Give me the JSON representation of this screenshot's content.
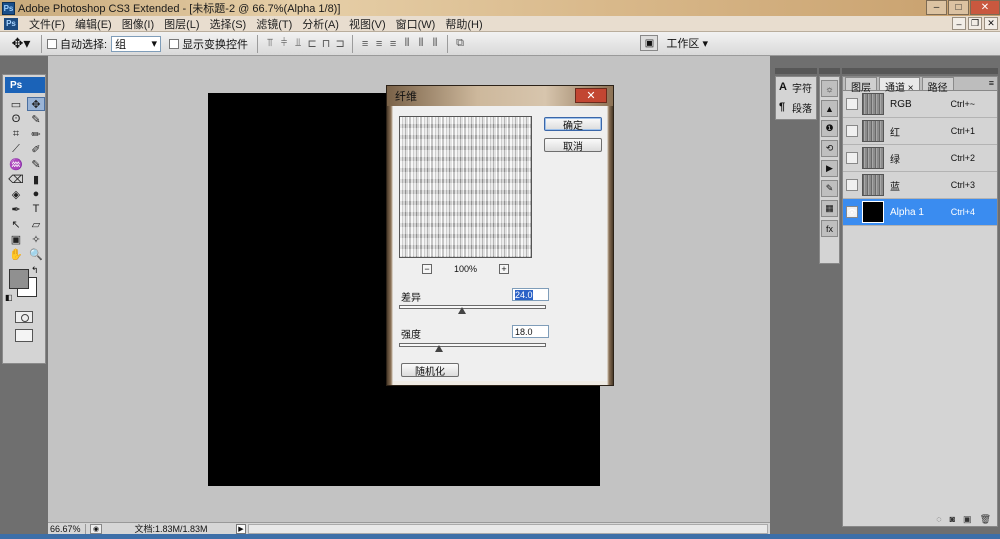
{
  "app": {
    "window_title": "Adobe Photoshop CS3 Extended - [未标题-2 @ 66.7%(Alpha 1/8)]",
    "icon": "Ps"
  },
  "menu": [
    "文件(F)",
    "编辑(E)",
    "图像(I)",
    "图层(L)",
    "选择(S)",
    "滤镜(T)",
    "分析(A)",
    "视图(V)",
    "窗口(W)",
    "帮助(H)"
  ],
  "options": {
    "auto_select_label": "自动选择:",
    "auto_select_value": "组",
    "show_transform_label": "显示变换控件",
    "workspace_label": "工作区 ▾"
  },
  "toolbox": {
    "logo": "Ps",
    "tools": [
      "▭",
      "✥",
      "ʘ",
      "✎",
      "⌗",
      "✏",
      "⟋",
      "✐",
      "♒",
      "✎",
      "⌫",
      "▮",
      "◈",
      "●",
      "✒",
      "T",
      "↖",
      "▱",
      "▣",
      "✧",
      "✋",
      "🔍"
    ]
  },
  "status": {
    "zoom": "66.67%",
    "doc_info": "文档:1.83M/1.83M"
  },
  "panels": {
    "strip_a": [
      {
        "icon": "A",
        "label": "字符"
      },
      {
        "icon": "¶",
        "label": "段落"
      }
    ],
    "strip_b": [
      "☼",
      "▲",
      "❶",
      "⟲",
      "▶",
      "✎",
      "▦",
      "fx"
    ],
    "tabs": [
      "图层",
      "通道 ×",
      "路径"
    ],
    "channels": [
      {
        "name": "RGB",
        "shortcut": "Ctrl+~"
      },
      {
        "name": "红",
        "shortcut": "Ctrl+1"
      },
      {
        "name": "绿",
        "shortcut": "Ctrl+2"
      },
      {
        "name": "蓝",
        "shortcut": "Ctrl+3"
      },
      {
        "name": "Alpha 1",
        "shortcut": "Ctrl+4"
      }
    ]
  },
  "dialog": {
    "title": "纤维",
    "ok_label": "确定",
    "cancel_label": "取消",
    "zoom": "100%",
    "variance_label": "差异",
    "variance_value": "24.0",
    "strength_label": "强度",
    "strength_value": "18.0",
    "randomize_label": "随机化",
    "variance_level_pct": 43,
    "strength_level_pct": 27
  },
  "colors": {
    "selected_channel": "#3a8cf0",
    "foreground": "#909090",
    "background": "#ffffff"
  }
}
